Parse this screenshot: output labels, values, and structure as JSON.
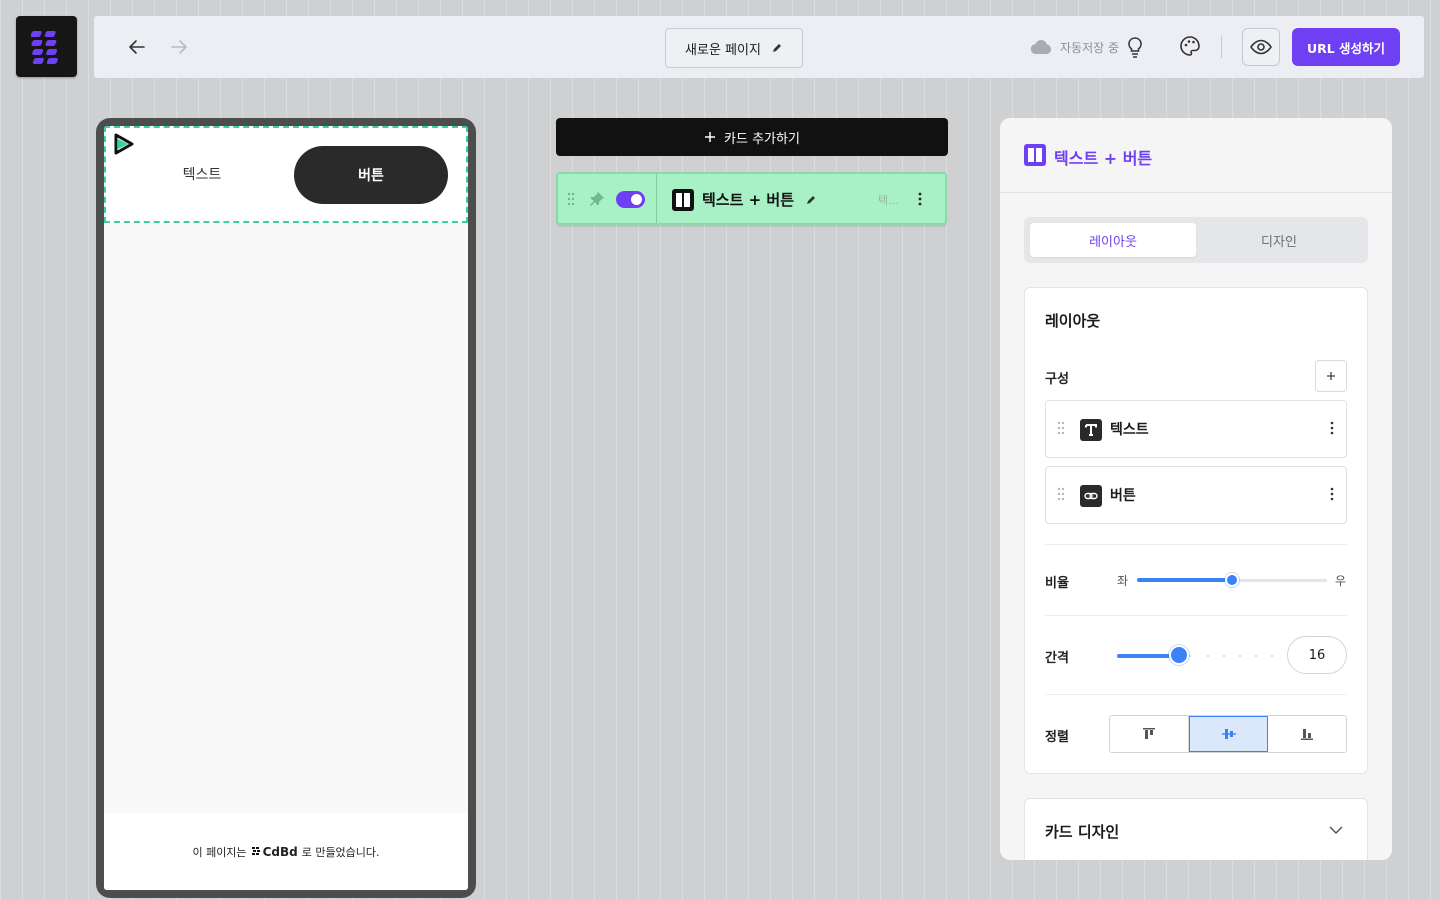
{
  "app": {
    "logo_icon": "app-logo-icon"
  },
  "topbar": {
    "page_title": "새로운 페이지",
    "autosave_label": "자동저장 중",
    "url_button_label": "URL 생성하기",
    "accent_color": "#6e3ff3"
  },
  "preview": {
    "text_label": "텍스트",
    "button_label": "버튼",
    "footer_prefix": "이 페이지는",
    "footer_brand": "CdBd",
    "footer_suffix": "로 만들었습니다."
  },
  "cards": {
    "add_button_label": "카드 추가하기",
    "items": [
      {
        "name": "텍스트 + 버튼",
        "subtitle": "텍...",
        "enabled": true,
        "color": "#a8f0c6"
      }
    ]
  },
  "panel": {
    "title": "텍스트 + 버튼",
    "tabs": [
      {
        "label": "레이아웃",
        "active": true
      },
      {
        "label": "디자인",
        "active": false
      }
    ],
    "layout": {
      "section_title": "레이아웃",
      "composition_label": "구성",
      "components": [
        {
          "label": "텍스트",
          "icon": "text-icon"
        },
        {
          "label": "버튼",
          "icon": "link-icon"
        }
      ],
      "ratio_label": "비율",
      "ratio_left": "좌",
      "ratio_right": "우",
      "ratio_value": 0.5,
      "gap_label": "간격",
      "gap_value": "16",
      "align_label": "정렬",
      "align_options": [
        "align-top-icon",
        "align-center-icon",
        "align-bottom-icon"
      ],
      "align_selected": 1
    },
    "card_design_title": "카드 디자인"
  }
}
